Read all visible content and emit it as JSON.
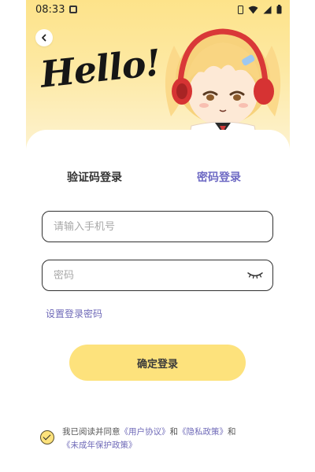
{
  "status_bar": {
    "time": "08:33"
  },
  "header": {
    "greeting": "Hello!",
    "back_icon": "chevron-left-icon"
  },
  "login_tabs": [
    {
      "label": "验证码登录",
      "active": false
    },
    {
      "label": "密码登录",
      "active": true
    }
  ],
  "form": {
    "phone_placeholder": "请输入手机号",
    "password_placeholder": "密码",
    "password_visibility_icon": "eye-closed-icon",
    "set_password_link": "设置登录密码",
    "submit_label": "确定登录"
  },
  "agreement": {
    "checked": true,
    "prefix": "我已阅读并同意",
    "user_agreement": "《用户协议》",
    "and1": "和",
    "privacy_policy": "《隐私政策》",
    "and2": "和",
    "minor_policy": "《未成年保护政策》"
  },
  "colors": {
    "hero_top": "#fde38a",
    "accent_purple": "#6e6ac4",
    "button_yellow": "#fde27c"
  }
}
